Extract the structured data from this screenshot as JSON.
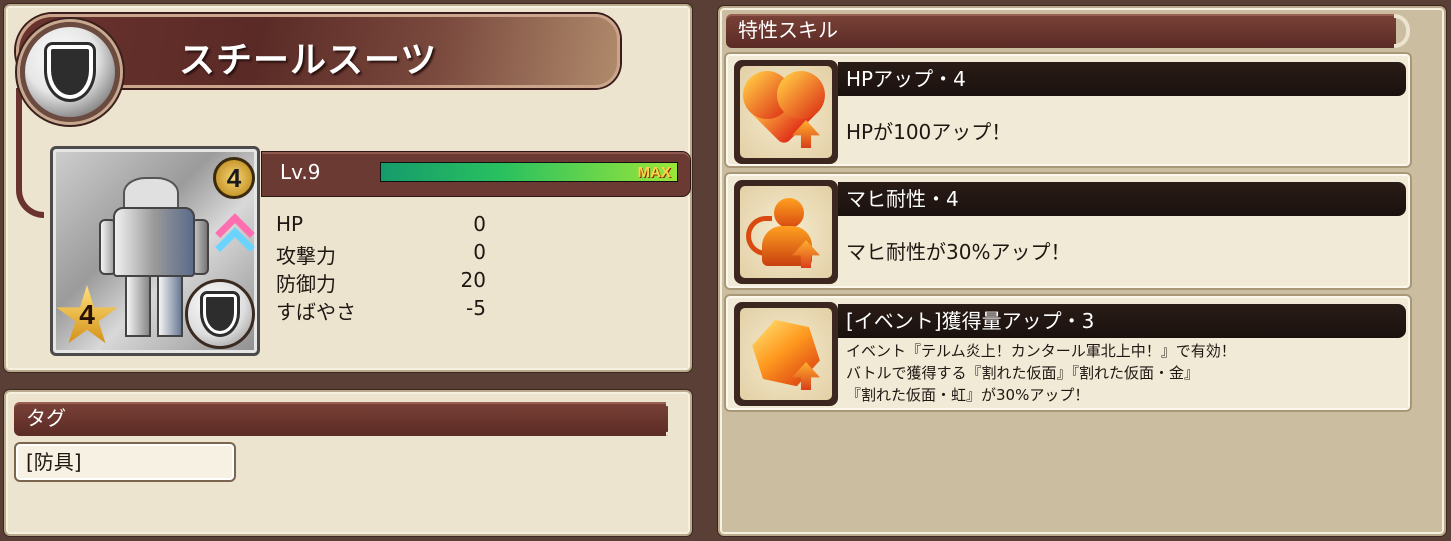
{
  "item": {
    "name": "スチールスーツ",
    "rarity": "4",
    "star": "4",
    "level_label": "Lv.9",
    "exp_fraction": 1.0,
    "exp_max_label": "MAX",
    "stats": [
      {
        "label": "HP",
        "value": "0"
      },
      {
        "label": "攻撃力",
        "value": "0"
      },
      {
        "label": "防御力",
        "value": "20"
      },
      {
        "label": "すばやさ",
        "value": "-5"
      }
    ]
  },
  "tags": {
    "header": "タグ",
    "items": [
      "[防具]"
    ]
  },
  "skills": {
    "header": "特性スキル",
    "items": [
      {
        "icon": "heart-up-icon",
        "title": "HPアップ・4",
        "desc": [
          "HPが100アップ！"
        ]
      },
      {
        "icon": "paralysis-resist-icon",
        "title": "マヒ耐性・4",
        "desc": [
          "マヒ耐性が30%アップ！"
        ]
      },
      {
        "icon": "gem-up-icon",
        "title": "[イベント]獲得量アップ・3",
        "desc": [
          "イベント『テルム炎上！カンタール軍北上中！』で有効！",
          "バトルで獲得する『割れた仮面』『割れた仮面・金』",
          "『割れた仮面・虹』が30%アップ！"
        ]
      }
    ]
  },
  "colors": {
    "background": "#5a3f37",
    "panel": "#ece4cf",
    "banner": "#6b332e",
    "exp_bar": "#28c060",
    "max_text": "#ffd34a"
  }
}
